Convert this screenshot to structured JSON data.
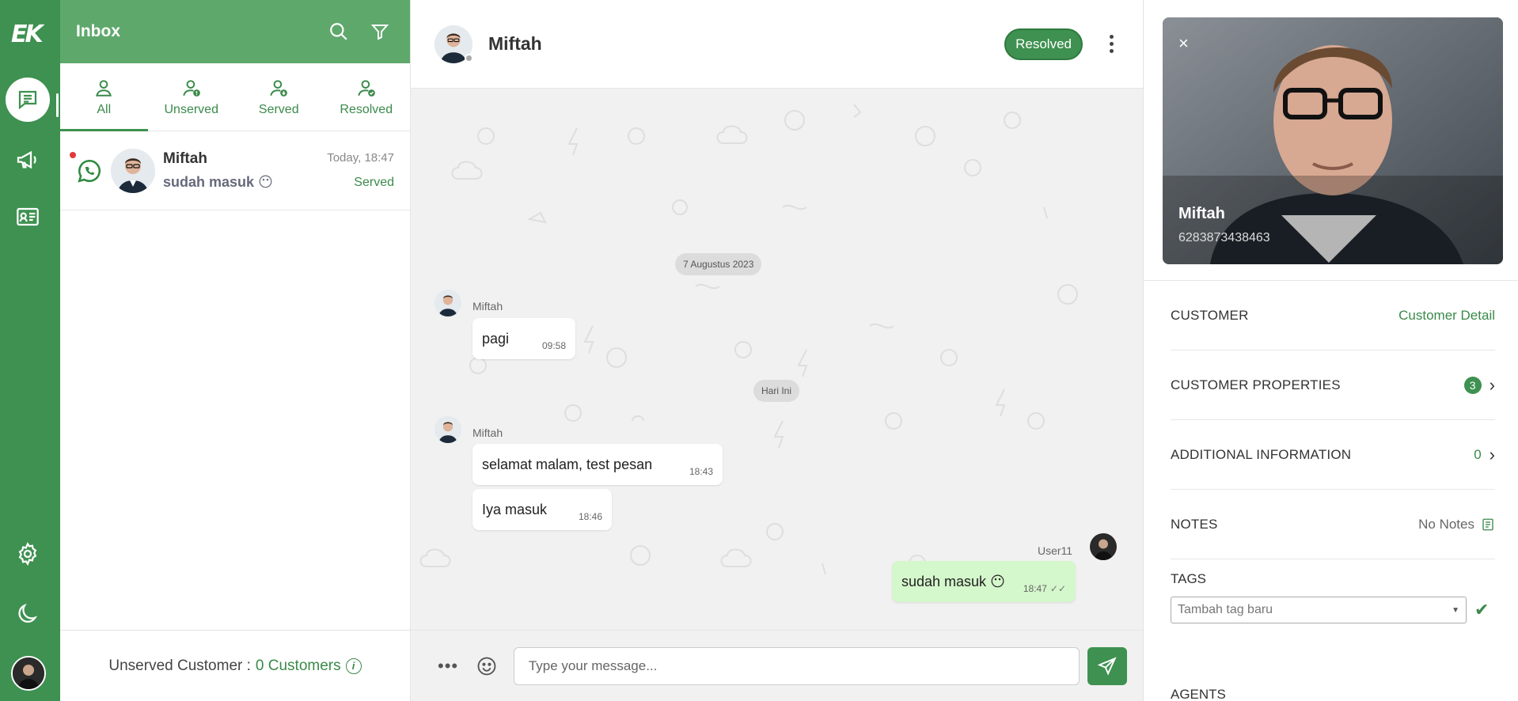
{
  "rail": {
    "logo": "EK",
    "nav": [
      "chat-icon",
      "megaphone-icon",
      "contact-card-icon",
      "gear-icon",
      "moon-icon"
    ]
  },
  "inbox": {
    "title": "Inbox",
    "tabs": [
      {
        "label": "All"
      },
      {
        "label": "Unserved"
      },
      {
        "label": "Served"
      },
      {
        "label": "Resolved"
      }
    ],
    "conversations": [
      {
        "name": "Miftah",
        "message": "sudah masuk",
        "emoji": "😶",
        "time": "Today, 18:47",
        "status": "Served",
        "channel": "whatsapp-icon"
      }
    ],
    "footer": {
      "label": "Unserved Customer :",
      "count": "0 Customers",
      "info": "i"
    }
  },
  "chat": {
    "name": "Miftah",
    "resolved_label": "Resolved",
    "date1": "7 Augustus 2023",
    "date2": "Hari Ini",
    "messages": [
      {
        "sender": "Miftah",
        "text": "pagi",
        "time": "09:58"
      },
      {
        "sender": "Miftah",
        "text": "selamat malam, test pesan",
        "time": "18:43"
      },
      {
        "sender": "",
        "text": "Iya masuk",
        "time": "18:46"
      },
      {
        "sender": "User11",
        "text": "sudah masuk",
        "emoji": "😶",
        "time": "18:47",
        "ticks": "✓✓"
      }
    ],
    "composer": {
      "more": "•••",
      "placeholder": "Type your message..."
    }
  },
  "detail": {
    "name": "Miftah",
    "phone": "6283873438463",
    "close": "×",
    "customer_label": "CUSTOMER",
    "customer_link": "Customer Detail",
    "properties_label": "CUSTOMER PROPERTIES",
    "properties_count": "3",
    "additional_label": "ADDITIONAL INFORMATION",
    "additional_count": "0",
    "notes_label": "NOTES",
    "notes_value": "No Notes",
    "tags_label": "TAGS",
    "tags_placeholder": "Tambah tag baru",
    "agents_label": "AGENTS"
  },
  "colors": {
    "primary": "#3e9150",
    "header_green": "#5fa86c",
    "outgoing_bubble": "#d4f7cb"
  }
}
